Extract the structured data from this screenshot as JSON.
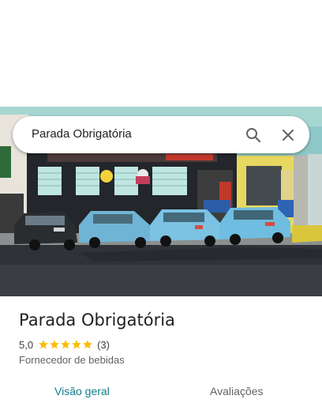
{
  "search": {
    "query": "Parada Obrigatória"
  },
  "place": {
    "name": "Parada Obrigatória",
    "rating": "5,0",
    "stars": 5,
    "review_count": "(3)",
    "category": "Fornecedor de bebidas"
  },
  "tabs": [
    {
      "label": "Visão geral",
      "active": true
    },
    {
      "label": "Avaliações",
      "active": false
    }
  ],
  "icons": {
    "search": "search-icon",
    "close": "close-icon",
    "star": "star-icon"
  },
  "colors": {
    "star": "#fbbc04",
    "active_tab": "#0f7d8c",
    "inactive_tab": "#5f6368"
  }
}
